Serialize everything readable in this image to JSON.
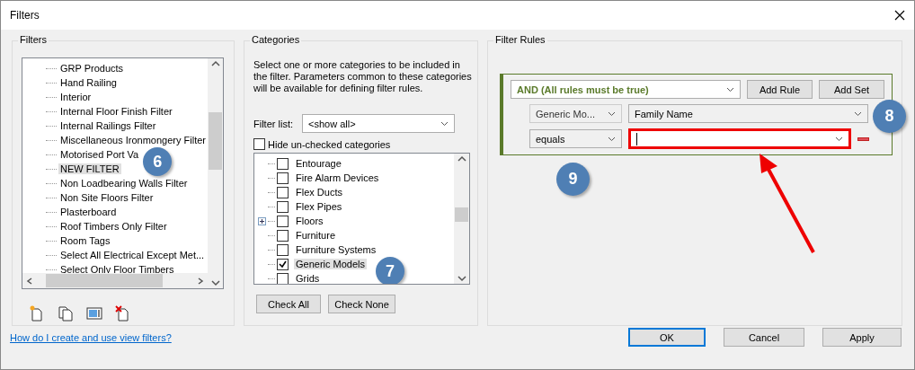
{
  "window": {
    "title": "Filters"
  },
  "filters": {
    "label": "Filters",
    "items": [
      {
        "label": "GRP Products",
        "selected": false
      },
      {
        "label": "Hand Railing",
        "selected": false
      },
      {
        "label": "Interior",
        "selected": false
      },
      {
        "label": "Internal Floor Finish Filter",
        "selected": false
      },
      {
        "label": "Internal Railings Filter",
        "selected": false
      },
      {
        "label": "Miscellaneous Ironmongery Filter",
        "selected": false
      },
      {
        "label": "Motorised Port Va",
        "selected": false
      },
      {
        "label": "NEW FILTER",
        "selected": true
      },
      {
        "label": "Non Loadbearing Walls Filter",
        "selected": false
      },
      {
        "label": "Non Site Floors Filter",
        "selected": false
      },
      {
        "label": "Plasterboard",
        "selected": false
      },
      {
        "label": "Roof Timbers Only Filter",
        "selected": false
      },
      {
        "label": "Room Tags",
        "selected": false
      },
      {
        "label": "Select All Electrical Except Met...",
        "selected": false
      },
      {
        "label": "Select Only Floor Timbers",
        "selected": false
      }
    ]
  },
  "categories": {
    "label": "Categories",
    "description": "Select one or more categories to be included in the filter.  Parameters common to these categories will be available for defining filter rules.",
    "filter_list": {
      "label": "Filter list:",
      "value": "<show all>"
    },
    "hide_unchecked": {
      "label": "Hide un-checked categories",
      "checked": false
    },
    "items": [
      {
        "label": "Entourage",
        "checked": false,
        "selected": false,
        "expandable": false
      },
      {
        "label": "Fire Alarm Devices",
        "checked": false,
        "selected": false,
        "expandable": false
      },
      {
        "label": "Flex Ducts",
        "checked": false,
        "selected": false,
        "expandable": false
      },
      {
        "label": "Flex Pipes",
        "checked": false,
        "selected": false,
        "expandable": false
      },
      {
        "label": "Floors",
        "checked": false,
        "selected": false,
        "expandable": true
      },
      {
        "label": "Furniture",
        "checked": false,
        "selected": false,
        "expandable": false
      },
      {
        "label": "Furniture Systems",
        "checked": false,
        "selected": false,
        "expandable": false
      },
      {
        "label": "Generic Models",
        "checked": true,
        "selected": true,
        "expandable": false
      },
      {
        "label": "Grids",
        "checked": false,
        "selected": false,
        "expandable": false
      }
    ],
    "buttons": [
      "Check All",
      "Check None"
    ]
  },
  "filter_rules": {
    "label": "Filter Rules",
    "operator": "AND (All rules must be true)",
    "buttons": [
      "Add Rule",
      "Add Set"
    ],
    "rule": {
      "category": "Generic Mo...",
      "parameter": "Family Name",
      "condition": "equals",
      "value_highlighted": true
    }
  },
  "help_link": "How do I create and use view filters?",
  "buttons": [
    {
      "label": "OK",
      "default": true
    },
    {
      "label": "Cancel",
      "default": false
    },
    {
      "label": "Apply",
      "default": false
    }
  ],
  "annotations": [
    {
      "label": "6"
    },
    {
      "label": "7"
    },
    {
      "label": "8"
    },
    {
      "label": "9"
    }
  ]
}
